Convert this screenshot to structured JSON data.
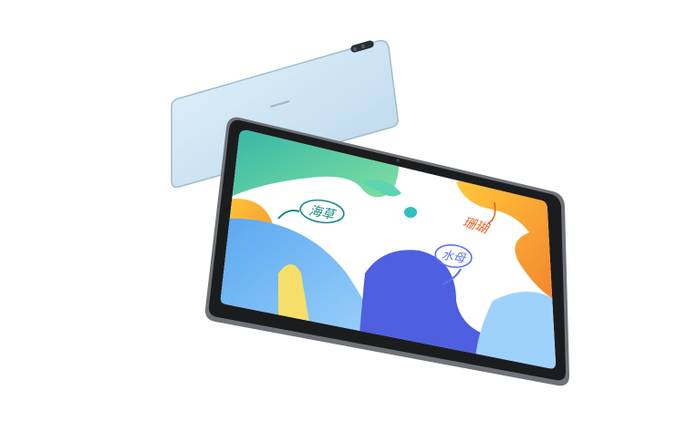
{
  "product": {
    "back_tablet_color": "#cfe6f5",
    "front_bezel_color": "#1b1c1e",
    "frame_color": "#6f7378"
  },
  "screen": {
    "annotations": [
      {
        "text": "海草",
        "color": "#1a8a86"
      },
      {
        "text": "水母",
        "color": "#5b6ff0"
      },
      {
        "text": "珊瑚",
        "color": "#e8622a"
      }
    ]
  }
}
